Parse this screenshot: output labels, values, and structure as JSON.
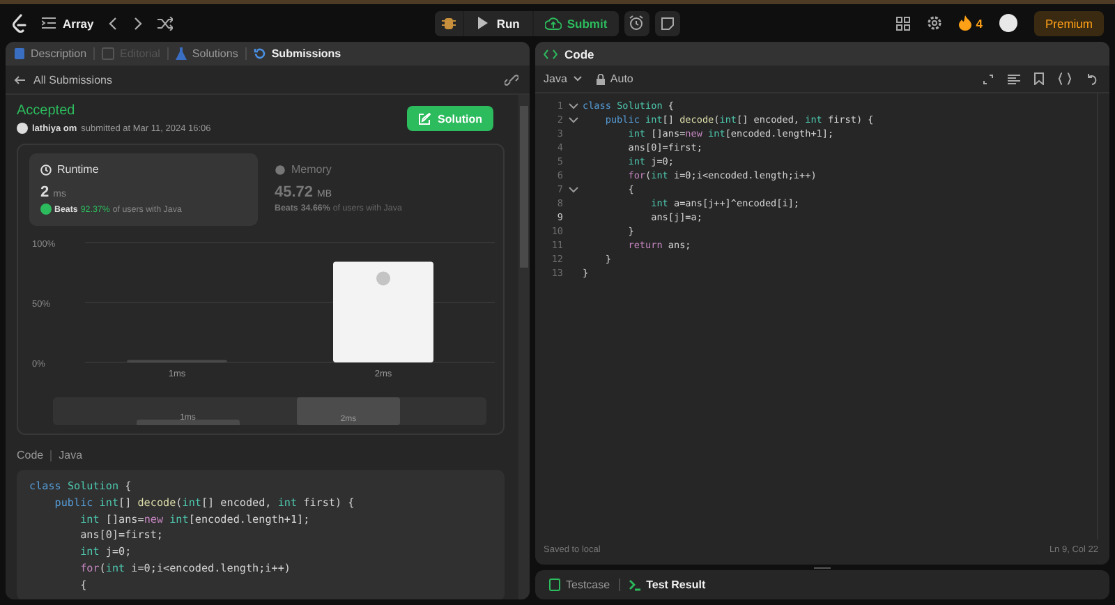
{
  "topbar": {
    "problem_list": "Array",
    "run": "Run",
    "submit": "Submit",
    "streak": "4",
    "premium": "Premium"
  },
  "left_tabs": [
    {
      "label": "Description",
      "selected": false,
      "disabled": false
    },
    {
      "label": "Editorial",
      "selected": false,
      "disabled": true
    },
    {
      "label": "Solutions",
      "selected": false,
      "disabled": false
    },
    {
      "label": "Submissions",
      "selected": true,
      "disabled": false
    }
  ],
  "back_link": "All Submissions",
  "submission": {
    "status": "Accepted",
    "user": "lathiya om",
    "submitted": "submitted at Mar 11, 2024 16:06",
    "solution_button": "Solution"
  },
  "stats": [
    {
      "title": "Runtime",
      "value": "2",
      "unit": "ms",
      "beats_label": "Beats",
      "beats": "92.37%",
      "suffix": "of users with Java",
      "selected": true
    },
    {
      "title": "Memory",
      "value": "45.72",
      "unit": "MB",
      "beats_label": "Beats",
      "beats": "34.66%",
      "suffix": "of users with Java",
      "selected": false
    }
  ],
  "distribution": {
    "chart_data": {
      "type": "bar",
      "categories": [
        "1ms",
        "2ms"
      ],
      "values": [
        2,
        84
      ],
      "ylim": [
        0,
        100
      ],
      "yticks": [
        {
          "value": 0,
          "label": "0%"
        },
        {
          "value": 50,
          "label": "50%"
        },
        {
          "value": 100,
          "label": "100%"
        }
      ]
    },
    "bars": [
      {
        "selected": false
      },
      {
        "selected": true
      }
    ],
    "overview": [
      {
        "label": "1ms",
        "selected": false
      },
      {
        "label": "2ms",
        "selected": true
      }
    ]
  },
  "code_section": {
    "title": "Code",
    "language": "Java",
    "lines": [
      {
        "tokens": [
          {
            "kind": "keyword",
            "text": "class "
          },
          {
            "kind": "type",
            "text": "Solution"
          },
          {
            "kind": "plain",
            "text": " {"
          }
        ]
      },
      {
        "tokens": [
          {
            "kind": "keyword",
            "text": "    public "
          },
          {
            "kind": "type",
            "text": "int"
          },
          {
            "kind": "plain",
            "text": "[] "
          },
          {
            "kind": "function",
            "text": "decode"
          },
          {
            "kind": "plain",
            "text": "("
          },
          {
            "kind": "type",
            "text": "int"
          },
          {
            "kind": "plain",
            "text": "[] encoded, "
          },
          {
            "kind": "type",
            "text": "int"
          },
          {
            "kind": "plain",
            "text": " first) {"
          }
        ]
      },
      {
        "tokens": [
          {
            "kind": "type",
            "text": "        int"
          },
          {
            "kind": "plain",
            "text": " []ans="
          },
          {
            "kind": "control",
            "text": "new "
          },
          {
            "kind": "type",
            "text": "int"
          },
          {
            "kind": "plain",
            "text": "[encoded.length+1];"
          }
        ]
      },
      {
        "tokens": [
          {
            "kind": "plain",
            "text": "        ans[0]=first;"
          }
        ]
      },
      {
        "tokens": [
          {
            "kind": "type",
            "text": "        int"
          },
          {
            "kind": "plain",
            "text": " j=0;"
          }
        ]
      },
      {
        "tokens": [
          {
            "kind": "control",
            "text": "        for"
          },
          {
            "kind": "plain",
            "text": "("
          },
          {
            "kind": "type",
            "text": "int"
          },
          {
            "kind": "plain",
            "text": " i=0;i<encoded.length;i++)"
          }
        ]
      },
      {
        "tokens": [
          {
            "kind": "plain",
            "text": "        {"
          }
        ]
      }
    ]
  },
  "editor": {
    "title": "Code",
    "language": "Java",
    "mode": "Auto",
    "status": "Saved to local",
    "cursor": "Ln 9, Col 22",
    "lines": [
      {
        "number": "1",
        "fold": true,
        "current": false,
        "tokens": [
          {
            "kind": "keyword",
            "text": "class "
          },
          {
            "kind": "type",
            "text": "Solution"
          },
          {
            "kind": "plain",
            "text": " {"
          }
        ]
      },
      {
        "number": "2",
        "fold": true,
        "current": false,
        "tokens": [
          {
            "kind": "keyword",
            "text": "    public "
          },
          {
            "kind": "type",
            "text": "int"
          },
          {
            "kind": "plain",
            "text": "[] "
          },
          {
            "kind": "function",
            "text": "decode"
          },
          {
            "kind": "plain",
            "text": "("
          },
          {
            "kind": "type",
            "text": "int"
          },
          {
            "kind": "plain",
            "text": "[] encoded, "
          },
          {
            "kind": "type",
            "text": "int"
          },
          {
            "kind": "plain",
            "text": " first) {"
          }
        ]
      },
      {
        "number": "3",
        "fold": false,
        "current": false,
        "tokens": [
          {
            "kind": "type",
            "text": "        int"
          },
          {
            "kind": "plain",
            "text": " []ans="
          },
          {
            "kind": "control",
            "text": "new "
          },
          {
            "kind": "type",
            "text": "int"
          },
          {
            "kind": "plain",
            "text": "[encoded.length+1];"
          }
        ]
      },
      {
        "number": "4",
        "fold": false,
        "current": false,
        "tokens": [
          {
            "kind": "plain",
            "text": "        ans[0]=first;"
          }
        ]
      },
      {
        "number": "5",
        "fold": false,
        "current": false,
        "tokens": [
          {
            "kind": "type",
            "text": "        int"
          },
          {
            "kind": "plain",
            "text": " j=0;"
          }
        ]
      },
      {
        "number": "6",
        "fold": false,
        "current": false,
        "tokens": [
          {
            "kind": "control",
            "text": "        for"
          },
          {
            "kind": "plain",
            "text": "("
          },
          {
            "kind": "type",
            "text": "int"
          },
          {
            "kind": "plain",
            "text": " i=0;i<encoded.length;i++)"
          }
        ]
      },
      {
        "number": "7",
        "fold": true,
        "current": false,
        "tokens": [
          {
            "kind": "plain",
            "text": "        {"
          }
        ]
      },
      {
        "number": "8",
        "fold": false,
        "current": false,
        "tokens": [
          {
            "kind": "type",
            "text": "            int"
          },
          {
            "kind": "plain",
            "text": " a=ans[j++]^encoded[i];"
          }
        ]
      },
      {
        "number": "9",
        "fold": false,
        "current": true,
        "tokens": [
          {
            "kind": "plain",
            "text": "            ans[j]=a;"
          }
        ]
      },
      {
        "number": "10",
        "fold": false,
        "current": false,
        "tokens": [
          {
            "kind": "plain",
            "text": "        }"
          }
        ]
      },
      {
        "number": "11",
        "fold": false,
        "current": false,
        "tokens": [
          {
            "kind": "control",
            "text": "        return"
          },
          {
            "kind": "plain",
            "text": " ans;"
          }
        ]
      },
      {
        "number": "12",
        "fold": false,
        "current": false,
        "tokens": [
          {
            "kind": "plain",
            "text": "    }"
          }
        ]
      },
      {
        "number": "13",
        "fold": false,
        "current": false,
        "tokens": [
          {
            "kind": "plain",
            "text": "}"
          }
        ]
      }
    ]
  },
  "bottom_tabs": [
    {
      "label": "Testcase",
      "selected": false
    },
    {
      "label": "Test Result",
      "selected": true
    }
  ]
}
